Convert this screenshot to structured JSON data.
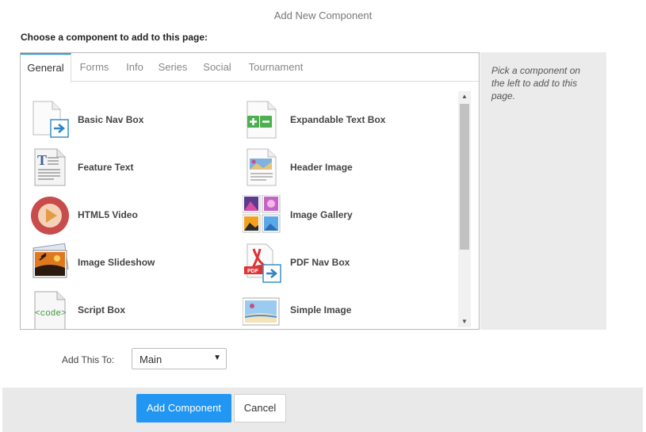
{
  "dialog": {
    "title": "Add New Component",
    "instruction": "Choose a component to add to this page:"
  },
  "tabs": [
    {
      "label": "General",
      "active": true
    },
    {
      "label": "Forms"
    },
    {
      "label": "Info"
    },
    {
      "label": "Series"
    },
    {
      "label": "Social"
    },
    {
      "label": "Tournament"
    }
  ],
  "components": [
    {
      "label": "Basic Nav Box",
      "icon": "doc-arrow-icon"
    },
    {
      "label": "Expandable Text Box",
      "icon": "plus-minus-doc-icon"
    },
    {
      "label": "Feature Text",
      "icon": "text-doc-icon"
    },
    {
      "label": "Header Image",
      "icon": "image-doc-icon"
    },
    {
      "label": "HTML5 Video",
      "icon": "play-icon"
    },
    {
      "label": "Image Gallery",
      "icon": "gallery-icon"
    },
    {
      "label": "Image Slideshow",
      "icon": "slideshow-icon"
    },
    {
      "label": "PDF Nav Box",
      "icon": "pdf-arrow-icon"
    },
    {
      "label": "Script Box",
      "icon": "code-doc-icon"
    },
    {
      "label": "Simple Image",
      "icon": "image-icon"
    }
  ],
  "help": {
    "text": "Pick a component on the left to add to this page."
  },
  "add_to": {
    "label": "Add This To:",
    "value": "Main"
  },
  "buttons": {
    "add": "Add Component",
    "cancel": "Cancel"
  },
  "colors": {
    "accent": "#2196f3",
    "tab_accent": "#2a9fd6"
  }
}
